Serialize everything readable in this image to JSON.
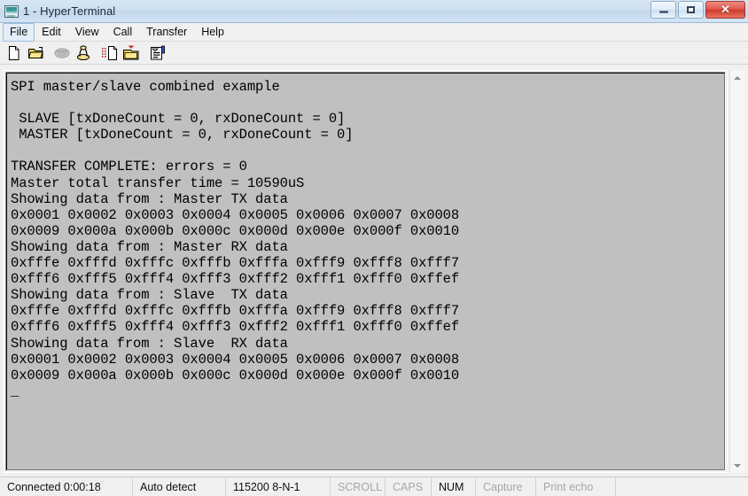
{
  "window": {
    "title": "1 - HyperTerminal",
    "icon": "monitor-icon",
    "buttons": {
      "minimize": "minimize-icon",
      "maximize": "maximize-icon",
      "close": "✕"
    }
  },
  "menubar": {
    "items": [
      {
        "label": "File",
        "active": true
      },
      {
        "label": "Edit",
        "active": false
      },
      {
        "label": "View",
        "active": false
      },
      {
        "label": "Call",
        "active": false
      },
      {
        "label": "Transfer",
        "active": false
      },
      {
        "label": "Help",
        "active": false
      }
    ]
  },
  "toolbar": {
    "buttons": [
      {
        "name": "new-connection-icon",
        "title": "New"
      },
      {
        "name": "open-folder-icon",
        "title": "Open"
      },
      {
        "name": "disconnect-phone-icon",
        "title": "Disconnect"
      },
      {
        "name": "call-phone-icon",
        "title": "Call"
      },
      {
        "name": "send-file-icon",
        "title": "Send"
      },
      {
        "name": "receive-file-icon",
        "title": "Receive"
      },
      {
        "name": "properties-icon",
        "title": "Properties"
      }
    ]
  },
  "terminal": {
    "background_color": "#c0c0c0",
    "text_color": "#000000",
    "cursor": "_",
    "lines": [
      "SPI master/slave combined example",
      "",
      " SLAVE [txDoneCount = 0, rxDoneCount = 0]",
      " MASTER [txDoneCount = 0, rxDoneCount = 0]",
      "",
      "TRANSFER COMPLETE: errors = 0",
      "Master total transfer time = 10590uS",
      "Showing data from : Master TX data",
      "0x0001 0x0002 0x0003 0x0004 0x0005 0x0006 0x0007 0x0008",
      "0x0009 0x000a 0x000b 0x000c 0x000d 0x000e 0x000f 0x0010",
      "Showing data from : Master RX data",
      "0xfffe 0xfffd 0xfffc 0xfffb 0xfffa 0xfff9 0xfff8 0xfff7",
      "0xfff6 0xfff5 0xfff4 0xfff3 0xfff2 0xfff1 0xfff0 0xffef",
      "Showing data from : Slave  TX data",
      "0xfffe 0xfffd 0xfffc 0xfffb 0xfffa 0xfff9 0xfff8 0xfff7",
      "0xfff6 0xfff5 0xfff4 0xfff3 0xfff2 0xfff1 0xfff0 0xffef",
      "Showing data from : Slave  RX data",
      "0x0001 0x0002 0x0003 0x0004 0x0005 0x0006 0x0007 0x0008",
      "0x0009 0x000a 0x000b 0x000c 0x000d 0x000e 0x000f 0x0010",
      "_"
    ]
  },
  "scrollbar": {
    "up_arrow": "scroll-up-icon",
    "down_arrow": "scroll-down-icon"
  },
  "statusbar": {
    "connected": "Connected 0:00:18",
    "detect": "Auto detect",
    "settings": "115200 8-N-1",
    "scroll": "SCROLL",
    "caps": "CAPS",
    "num": "NUM",
    "capture": "Capture",
    "print_echo": "Print echo"
  }
}
